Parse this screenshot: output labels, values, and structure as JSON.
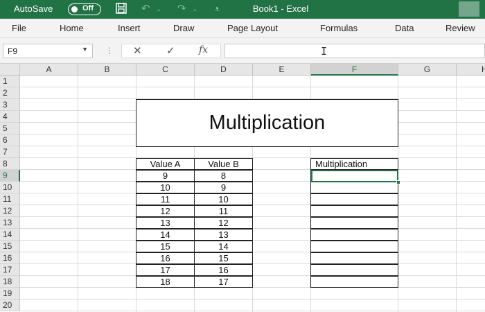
{
  "titlebar": {
    "autosave_label": "AutoSave",
    "toggle_label": "Off",
    "title": "Book1  -  Excel"
  },
  "ribbon": {
    "tabs": [
      "File",
      "Home",
      "Insert",
      "Draw",
      "Page Layout",
      "Formulas",
      "Data",
      "Review"
    ]
  },
  "formula_bar": {
    "name_box": "F9",
    "formula": ""
  },
  "sheet": {
    "columns": [
      "A",
      "B",
      "C",
      "D",
      "E",
      "F",
      "G",
      "H"
    ],
    "rows": [
      "1",
      "2",
      "3",
      "4",
      "5",
      "6",
      "7",
      "8",
      "9",
      "10",
      "11",
      "12",
      "13",
      "14",
      "15",
      "16",
      "17",
      "18",
      "19",
      "20"
    ],
    "selected_cell": "F9",
    "title": "Multiplication",
    "table": {
      "headers": [
        "Value A",
        "Value B"
      ],
      "rows": [
        [
          "9",
          "8"
        ],
        [
          "10",
          "9"
        ],
        [
          "11",
          "10"
        ],
        [
          "12",
          "11"
        ],
        [
          "13",
          "12"
        ],
        [
          "14",
          "13"
        ],
        [
          "15",
          "14"
        ],
        [
          "16",
          "15"
        ],
        [
          "17",
          "16"
        ],
        [
          "18",
          "17"
        ]
      ]
    },
    "result_header": "Multiplication"
  },
  "colors": {
    "excel_green": "#217346"
  }
}
